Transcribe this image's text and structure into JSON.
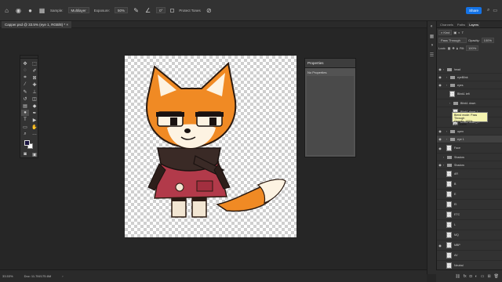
{
  "options_bar": {
    "sample_label": "Sample:",
    "sample_value": "Multilayer",
    "exposure_label": "Exposure:",
    "exposure_value": "50%",
    "angle_value": "0°",
    "protect_tones_label": "Protect Tones",
    "share_label": "Share"
  },
  "document_tab": {
    "title": "Capper.psd @ 33.5% (eye 1, RGB/8) *"
  },
  "properties_panel": {
    "title": "Properties",
    "subtitle": "No Properties"
  },
  "layers_panel": {
    "tabs": [
      "Channels",
      "Paths",
      "Layers"
    ],
    "active_tab": "Layers",
    "filter_label": "Kind",
    "blend_mode": "Pass Through",
    "opacity_label": "Opacity:",
    "opacity_value": "100%",
    "lock_label": "Lock:",
    "fill_label": "Fill:",
    "fill_value": "100%",
    "layers": [
      {
        "name": "head",
        "type": "group",
        "visible": true,
        "indent": 0
      },
      {
        "name": "eyeBlink",
        "type": "group",
        "visible": true,
        "indent": 1
      },
      {
        "name": "eyes",
        "type": "group",
        "visible": true,
        "indent": 1
      },
      {
        "name": "Blink1 left",
        "type": "layer",
        "visible": false,
        "indent": 2
      },
      {
        "name": "Blink1 down",
        "type": "group",
        "visible": false,
        "indent": 2
      },
      {
        "name": "Blink1 down_L",
        "type": "layer",
        "visible": false,
        "indent": 3
      },
      {
        "name": "Blink1 down_R",
        "type": "layer",
        "visible": false,
        "indent": 3
      },
      {
        "name": "open",
        "type": "group",
        "visible": true,
        "indent": 1
      },
      {
        "name": "eye 1",
        "type": "group",
        "visible": true,
        "indent": 1,
        "selected": true
      },
      {
        "name": "Face",
        "type": "layer",
        "visible": true,
        "indent": 1
      },
      {
        "name": "Shadow",
        "type": "group",
        "visible": false,
        "indent": 0
      },
      {
        "name": "Shadow",
        "type": "group",
        "visible": true,
        "indent": 0
      },
      {
        "name": "AR",
        "type": "layer",
        "visible": false,
        "indent": 1
      },
      {
        "name": "B",
        "type": "layer",
        "visible": false,
        "indent": 1
      },
      {
        "name": "E",
        "type": "layer",
        "visible": false,
        "indent": 1
      },
      {
        "name": "EI",
        "type": "layer",
        "visible": false,
        "indent": 1
      },
      {
        "name": "ETC",
        "type": "layer",
        "visible": false,
        "indent": 1
      },
      {
        "name": "L",
        "type": "layer",
        "visible": false,
        "indent": 1
      },
      {
        "name": "MQ",
        "type": "layer",
        "visible": false,
        "indent": 1
      },
      {
        "name": "MBP",
        "type": "layer",
        "visible": true,
        "indent": 1
      },
      {
        "name": "AV",
        "type": "layer",
        "visible": false,
        "indent": 1
      },
      {
        "name": "Neutral",
        "type": "layer",
        "visible": false,
        "indent": 1
      },
      {
        "name": "AI 1",
        "type": "layer",
        "visible": false,
        "indent": 1
      },
      {
        "name": "Smile Open",
        "type": "layer",
        "visible": false,
        "indent": 1
      }
    ]
  },
  "tooltip": {
    "lines": [
      "Blend mode: Pass Through",
      "Opacity: 100%",
      "Fill: 100%"
    ]
  },
  "status_bar": {
    "zoom": "33.53%",
    "doc_info": "Doc: 11.7M/175.6M"
  },
  "colors": {
    "accent": "#1473e6",
    "foreground_swatch": "#1a1440",
    "background_swatch": "#ffffff"
  }
}
